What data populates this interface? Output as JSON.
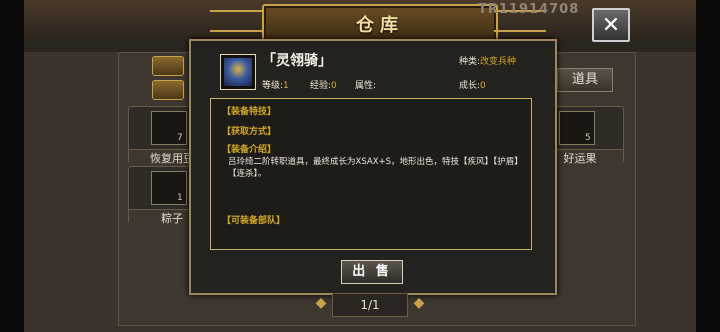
{
  "window": {
    "title": "仓库",
    "player_id": "TR11914708",
    "close_label": "✕"
  },
  "inventory": {
    "tab_label": "道具",
    "items": [
      {
        "name": "恢复用豆",
        "count": "7"
      },
      {
        "name": "粽子",
        "count": "1"
      },
      {
        "name": "好运果",
        "count": "5"
      }
    ]
  },
  "detail": {
    "item_name": "「灵翎骑」",
    "type_label": "种类:",
    "type_value": "改变兵种",
    "level_label": "等级:",
    "level_value": "1",
    "exp_label": "经验:",
    "exp_value": "0",
    "attr_label": "属性:",
    "growth_label": "成长:",
    "growth_value": "0",
    "section_skill": "【装备特技】",
    "section_source": "【获取方式】",
    "section_intro": "【装备介绍】",
    "intro_text": "吕玲绮二阶转职道具，最终成长为XSAX+S，地形出色，特技【疾风】【护盾】【连杀】。",
    "section_units": "【可装备部队】",
    "sell_label": "出 售"
  },
  "pager": {
    "text": "1/1"
  },
  "colors": {
    "accent_gold": "#d4a92a",
    "frame_gold": "#c9a24a"
  }
}
